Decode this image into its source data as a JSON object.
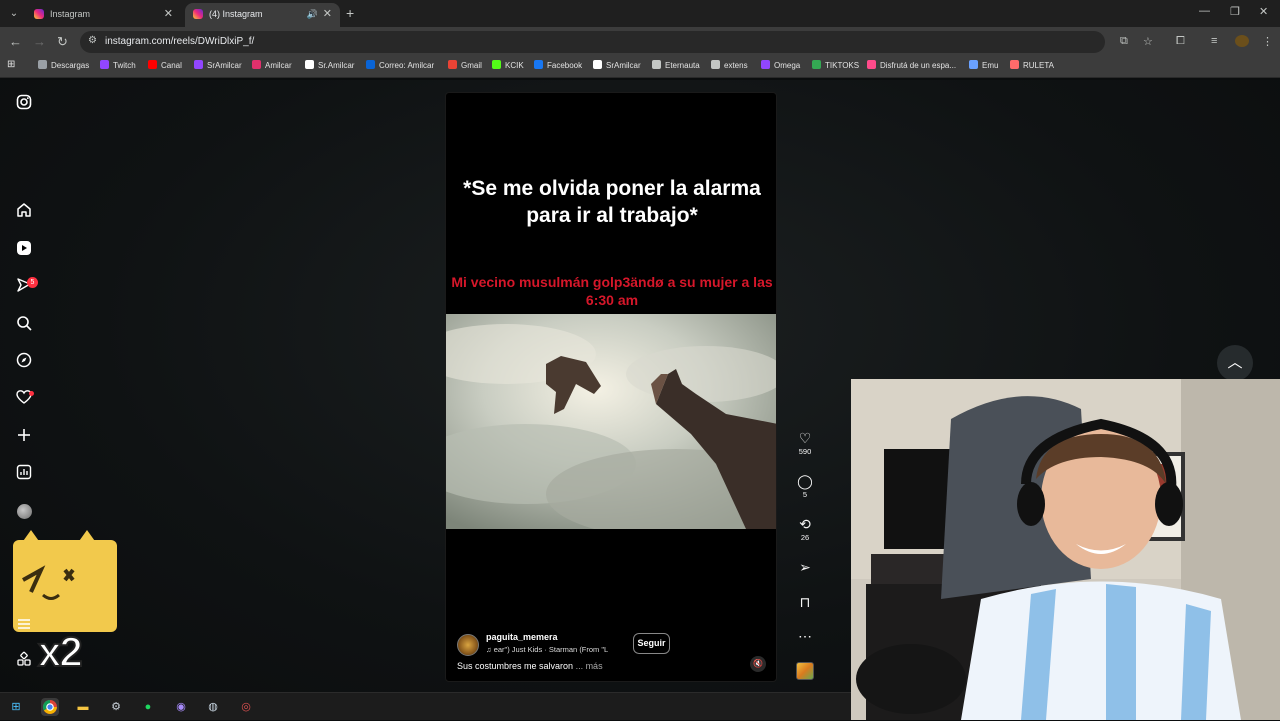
{
  "browser": {
    "tabs": [
      {
        "title": "Instagram",
        "active": false
      },
      {
        "title": "(4) Instagram",
        "active": true
      }
    ],
    "url": "instagram.com/reels/DWriDlxiP_f/",
    "bookmarks": [
      {
        "label": "Descargas",
        "icon": "download-icon",
        "color": "#9aa0a6"
      },
      {
        "label": "Twitch",
        "icon": "twitch-icon",
        "color": "#9146ff"
      },
      {
        "label": "Canal",
        "icon": "youtube-icon",
        "color": "#ff0000"
      },
      {
        "label": "SrAmilcar",
        "icon": "twitch-icon",
        "color": "#9146ff"
      },
      {
        "label": "Amilcar",
        "icon": "instagram-icon",
        "color": "#e1306c"
      },
      {
        "label": "Sr.Amilcar",
        "icon": "x-icon",
        "color": "#ffffff"
      },
      {
        "label": "Correo: Amilcar",
        "icon": "outlook-icon",
        "color": "#0a64d6"
      },
      {
        "label": "Gmail",
        "icon": "gmail-icon",
        "color": "#ea4335"
      },
      {
        "label": "KCIK",
        "icon": "kick-icon",
        "color": "#53fc18"
      },
      {
        "label": "Facebook",
        "icon": "facebook-icon",
        "color": "#1877f2"
      },
      {
        "label": "SrAmilcar",
        "icon": "tiktok-icon",
        "color": "#ffffff"
      },
      {
        "label": "Eternauta",
        "icon": "page-icon",
        "color": "#c4c7c5"
      },
      {
        "label": "extens",
        "icon": "extension-icon",
        "color": "#c4c7c5"
      },
      {
        "label": "Omega",
        "icon": "twitch-icon",
        "color": "#9146ff"
      },
      {
        "label": "TIKTOKS",
        "icon": "drive-icon",
        "color": "#34a853"
      },
      {
        "label": "Disfrutá de un espa...",
        "icon": "site-icon",
        "color": "#ff4b8b"
      },
      {
        "label": "Emu",
        "icon": "emu-icon",
        "color": "#6aa1ff"
      },
      {
        "label": "RULETA",
        "icon": "wheel-icon",
        "color": "#ff6b6b"
      }
    ]
  },
  "instagram": {
    "notification_count": "5",
    "reel": {
      "caption_main": "*Se me olvida poner la alarma para ir al trabajo*",
      "caption_red": "Mi vecino musulmán golp3ändø a su mujer a las 6:30 am",
      "author": "paguita_memera",
      "music": "♫  ear\")  Just Kids · Starman (From \"L",
      "follow_label": "Seguir",
      "description": "Sus costumbres me salvaron",
      "more_label": "... más",
      "likes": "590",
      "comments": "5",
      "reposts": "26"
    }
  },
  "overlay": {
    "multiplier": "x2"
  }
}
